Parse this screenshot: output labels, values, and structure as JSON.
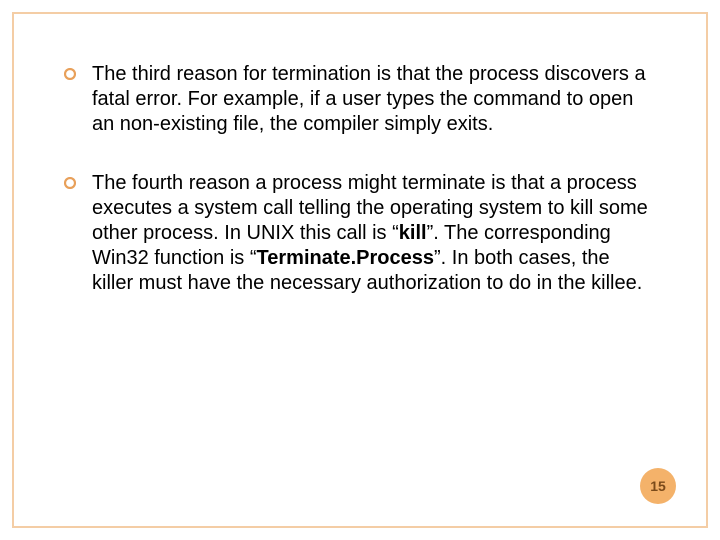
{
  "bullets": [
    {
      "text": "The third reason for termination is that the process discovers a fatal error. For example, if a user types the command to open an non-existing file, the compiler simply exits."
    },
    {
      "prefix": "The fourth reason a process might terminate is that a process executes a system call telling the operating system to kill some other process. In UNIX this call is “",
      "bold1": "kill",
      "mid1": "”. The corresponding Win32 function is “",
      "bold2": "Terminate.Process",
      "suffix": "”. In both cases, the killer must have the necessary authorization to do in the killee."
    }
  ],
  "page_number": "15"
}
